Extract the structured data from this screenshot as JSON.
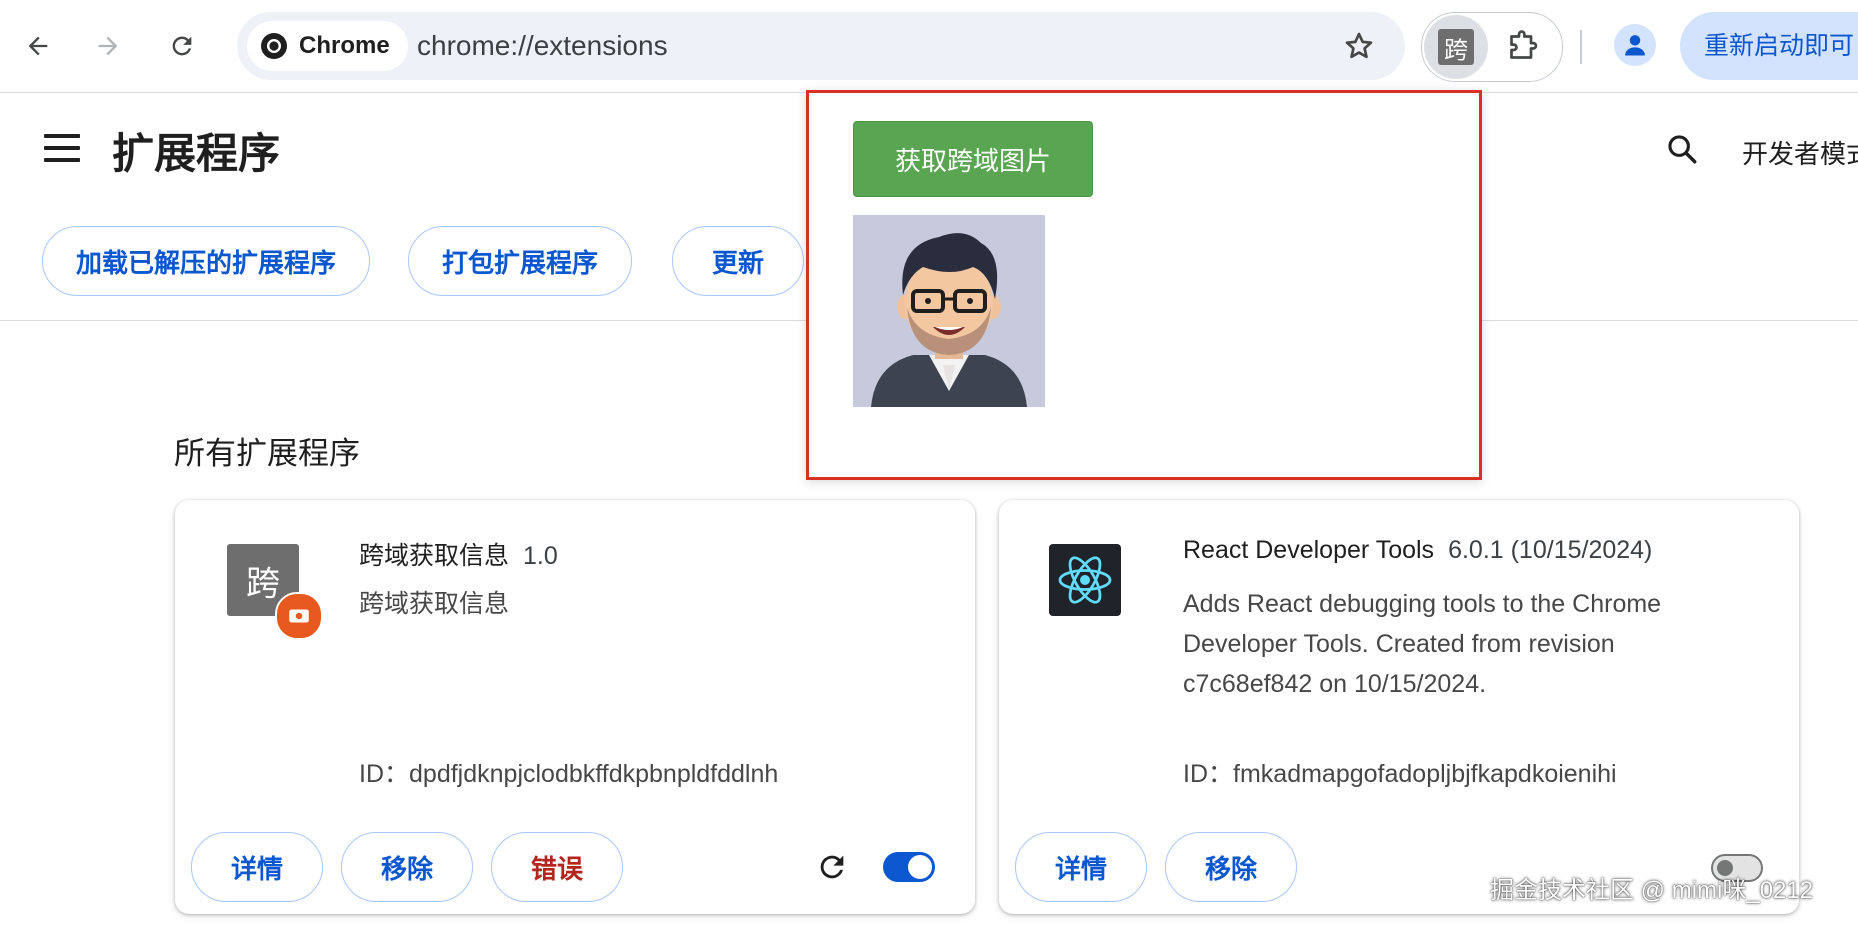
{
  "browser": {
    "chip_label": "Chrome",
    "url": "chrome://extensions",
    "active_extension_char": "跨",
    "restart_label": "重新启动即可"
  },
  "header": {
    "title": "扩展程序",
    "dev_mode_label": "开发者模式"
  },
  "actions": {
    "load_unpacked": "加载已解压的扩展程序",
    "pack": "打包扩展程序",
    "update": "更新"
  },
  "section_title": "所有扩展程序",
  "extensions": [
    {
      "icon_char": "跨",
      "name": "跨域获取信息",
      "version": "1.0",
      "description": "跨域获取信息",
      "id_label": "ID：",
      "id": "dpdfjdknpjclodbkffdkpbnpldfddlnh",
      "details": "详情",
      "remove": "移除",
      "errors": "错误",
      "enabled": true
    },
    {
      "name": "React Developer Tools",
      "version": "6.0.1 (10/15/2024)",
      "description": "Adds React debugging tools to the Chrome Developer Tools. Created from revision c7c68ef842 on 10/15/2024.",
      "id_label": "ID：",
      "id": "fmkadmapgofadopljbjfkapdkoienihi",
      "details": "详情",
      "remove": "移除",
      "enabled": false
    }
  ],
  "popup": {
    "button_label": "获取跨域图片"
  },
  "watermark": "掘金技术社区 @ mimi咪_0212",
  "colors": {
    "accent": "#0b57d0",
    "error": "#b3261e",
    "popup_button": "#5aa552",
    "highlight_border": "#d93025"
  }
}
